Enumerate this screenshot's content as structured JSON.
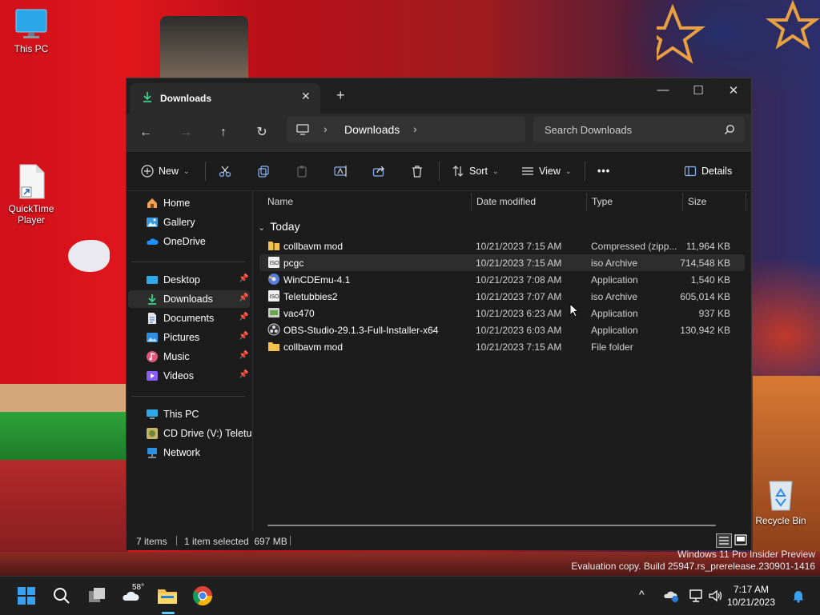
{
  "desktop": {
    "icons": [
      {
        "label": "This PC"
      },
      {
        "label": "QuickTime Player"
      },
      {
        "label": "Recycle Bin"
      }
    ],
    "watermark": {
      "line1": "Windows 11 Pro Insider Preview",
      "line2": "Evaluation copy. Build 25947.rs_prerelease.230901-1416"
    }
  },
  "window": {
    "tab_title": "Downloads",
    "breadcrumb": "Downloads",
    "search_placeholder": "Search Downloads",
    "commands": {
      "new": "New",
      "sort": "Sort",
      "view": "View",
      "more": "•••",
      "details": "Details"
    },
    "nav": {
      "quick": [
        {
          "label": "Home"
        },
        {
          "label": "Gallery"
        },
        {
          "label": "OneDrive"
        }
      ],
      "pinned": [
        {
          "label": "Desktop"
        },
        {
          "label": "Downloads"
        },
        {
          "label": "Documents"
        },
        {
          "label": "Pictures"
        },
        {
          "label": "Music"
        },
        {
          "label": "Videos"
        }
      ],
      "devices": [
        {
          "label": "This PC"
        },
        {
          "label": "CD Drive (V:) Teletubbies"
        },
        {
          "label": "Network"
        }
      ]
    },
    "columns": {
      "name": "Name",
      "date": "Date modified",
      "type": "Type",
      "size": "Size"
    },
    "group": "Today",
    "files": [
      {
        "name": "collbavm mod",
        "date": "10/21/2023 7:15 AM",
        "type": "Compressed (zipp...",
        "size": "11,964 KB",
        "icon": "zip-folder-icon"
      },
      {
        "name": "pcgc",
        "date": "10/21/2023 7:15 AM",
        "type": "iso Archive",
        "size": "714,548 KB",
        "icon": "iso-icon"
      },
      {
        "name": "WinCDEmu-4.1",
        "date": "10/21/2023 7:08 AM",
        "type": "Application",
        "size": "1,540 KB",
        "icon": "app-icon"
      },
      {
        "name": "Teletubbies2",
        "date": "10/21/2023 7:07 AM",
        "type": "iso Archive",
        "size": "605,014 KB",
        "icon": "iso-icon"
      },
      {
        "name": "vac470",
        "date": "10/21/2023 6:23 AM",
        "type": "Application",
        "size": "937 KB",
        "icon": "installer-icon"
      },
      {
        "name": "OBS-Studio-29.1.3-Full-Installer-x64",
        "date": "10/21/2023 6:03 AM",
        "type": "Application",
        "size": "130,942 KB",
        "icon": "obs-icon"
      },
      {
        "name": "collbavm mod",
        "date": "10/21/2023 7:15 AM",
        "type": "File folder",
        "size": "",
        "icon": "folder-icon"
      }
    ],
    "status": {
      "count": "7 items",
      "selection": "1 item selected  697 MB"
    }
  },
  "taskbar": {
    "weather_temp": "58°",
    "time": "7:17 AM",
    "date": "10/21/2023"
  }
}
